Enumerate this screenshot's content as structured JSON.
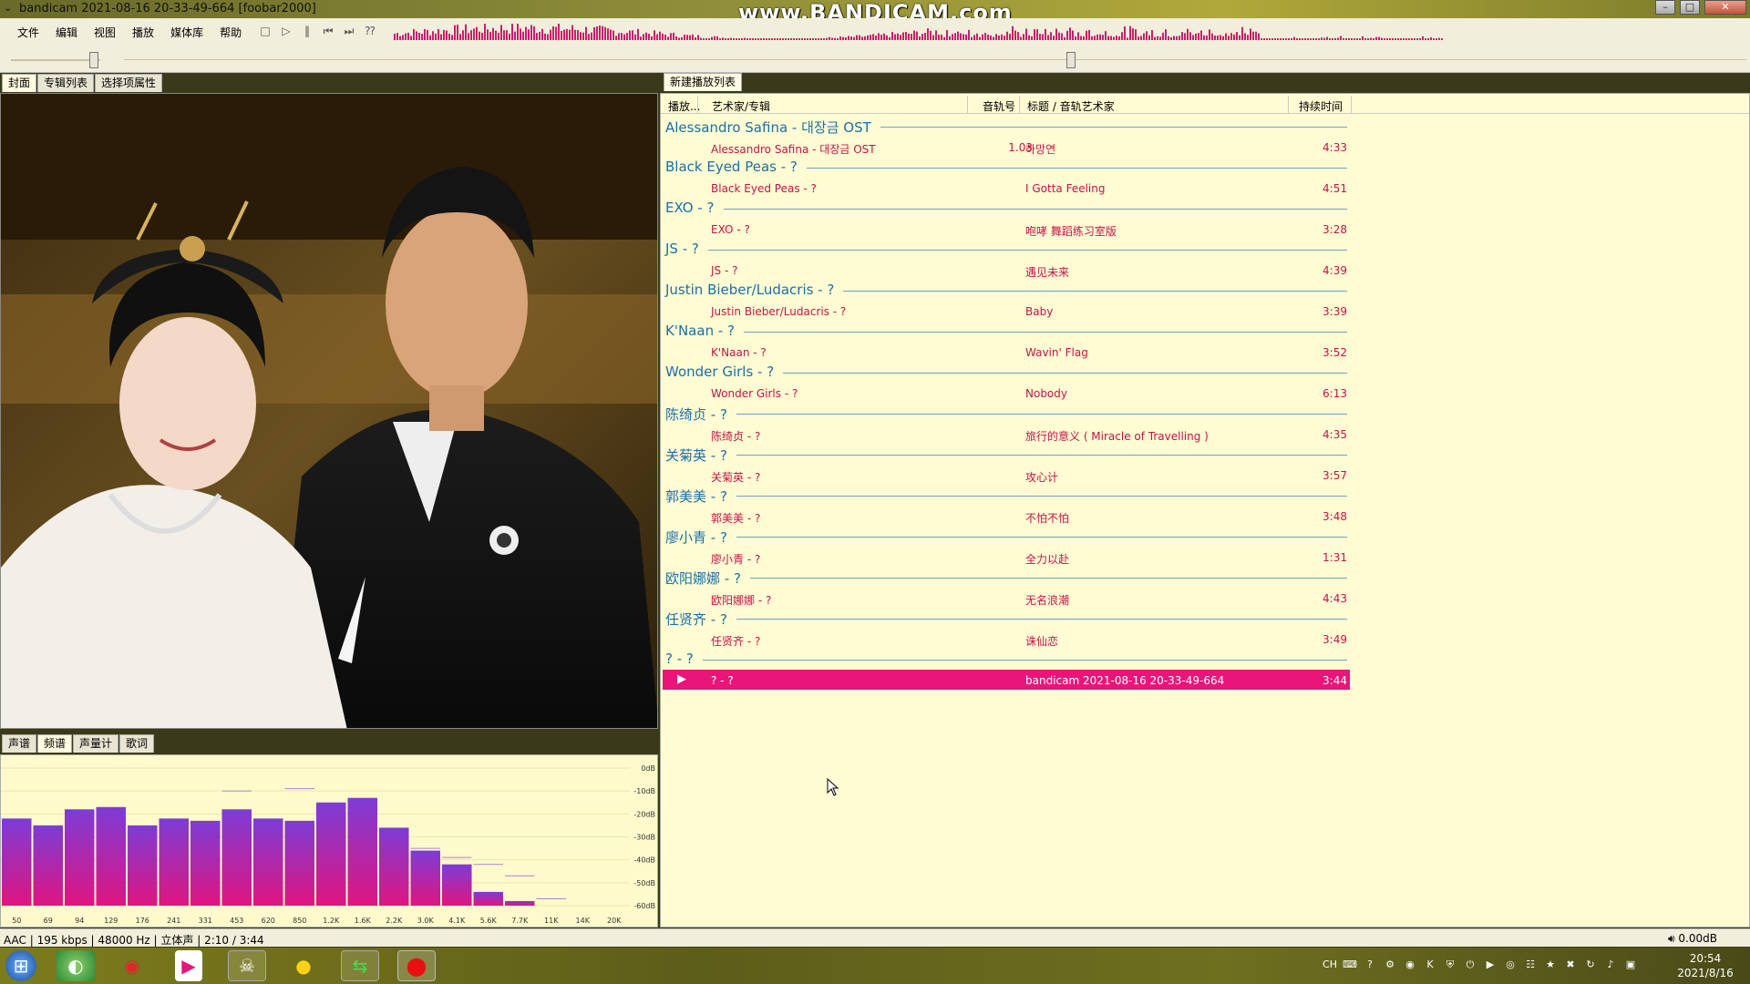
{
  "window": {
    "title": "bandicam 2021-08-16 20-33-49-664  [foobar2000]",
    "watermark": "www.BANDICAM.com",
    "controls": [
      "–",
      "□",
      "✕"
    ]
  },
  "menu": [
    "文件",
    "编辑",
    "视图",
    "播放",
    "媒体库",
    "帮助"
  ],
  "transport": [
    {
      "name": "stop-icon",
      "glyph": "□"
    },
    {
      "name": "play-icon",
      "glyph": "▷"
    },
    {
      "name": "pause-icon",
      "glyph": "‖"
    },
    {
      "name": "previous-icon",
      "glyph": "⏮"
    },
    {
      "name": "next-icon",
      "glyph": "⏭"
    },
    {
      "name": "random-icon",
      "glyph": "⁇"
    }
  ],
  "left_top_tabs": [
    "封面",
    "专辑列表",
    "选择项属性"
  ],
  "left_bottom_tabs": [
    "声谱",
    "频谱",
    "声量计",
    "歌词"
  ],
  "right_tabs": [
    "新建播放列表"
  ],
  "playlist": {
    "columns": {
      "playing": "播放...",
      "artist_album": "艺术家/专辑",
      "track_no": "音轨号",
      "title_artist": "标题 / 音轨艺术家",
      "duration": "持续时间"
    },
    "groups": [
      {
        "header": "Alessandro Safina - 대장금 OST",
        "tracks": [
          {
            "artist": "Alessandro Safina - 대장금 OST",
            "num": "1.03",
            "title": "하망연",
            "duration": "4:33"
          }
        ]
      },
      {
        "header": "Black Eyed Peas - ?",
        "tracks": [
          {
            "artist": "Black Eyed Peas - ?",
            "num": "",
            "title": "I Gotta Feeling",
            "duration": "4:51"
          }
        ]
      },
      {
        "header": "EXO - ?",
        "tracks": [
          {
            "artist": "EXO - ?",
            "num": "",
            "title": "咆哮 舞蹈练习室版",
            "duration": "3:28"
          }
        ]
      },
      {
        "header": "JS - ?",
        "tracks": [
          {
            "artist": "JS - ?",
            "num": "",
            "title": "遇见未来",
            "duration": "4:39"
          }
        ]
      },
      {
        "header": "Justin Bieber/Ludacris - ?",
        "tracks": [
          {
            "artist": "Justin Bieber/Ludacris - ?",
            "num": "",
            "title": "Baby",
            "duration": "3:39"
          }
        ]
      },
      {
        "header": "K'Naan - ?",
        "tracks": [
          {
            "artist": "K'Naan - ?",
            "num": "",
            "title": "Wavin' Flag",
            "duration": "3:52"
          }
        ]
      },
      {
        "header": "Wonder Girls - ?",
        "tracks": [
          {
            "artist": "Wonder Girls - ?",
            "num": "",
            "title": "Nobody",
            "duration": "6:13"
          }
        ]
      },
      {
        "header": "陈绮贞 - ?",
        "tracks": [
          {
            "artist": "陈绮贞 - ?",
            "num": "",
            "title": "旅行的意义 ( Miracle of Travelling )",
            "duration": "4:35"
          }
        ]
      },
      {
        "header": "关菊英 - ?",
        "tracks": [
          {
            "artist": "关菊英 - ?",
            "num": "",
            "title": "攻心计",
            "duration": "3:57"
          }
        ]
      },
      {
        "header": "郭美美 - ?",
        "tracks": [
          {
            "artist": "郭美美 - ?",
            "num": "",
            "title": "不怕不怕",
            "duration": "3:48"
          }
        ]
      },
      {
        "header": "廖小青 - ?",
        "tracks": [
          {
            "artist": "廖小青 - ?",
            "num": "",
            "title": "全力以赴",
            "duration": "1:31"
          }
        ]
      },
      {
        "header": "欧阳娜娜 - ?",
        "tracks": [
          {
            "artist": "欧阳娜娜 - ?",
            "num": "",
            "title": "无名浪潮",
            "duration": "4:43"
          }
        ]
      },
      {
        "header": "任贤齐 - ?",
        "tracks": [
          {
            "artist": "任贤齐 - ?",
            "num": "",
            "title": "诛仙恋",
            "duration": "3:49"
          }
        ]
      },
      {
        "header": "? - ?",
        "tracks": [
          {
            "artist": "? - ?",
            "num": "",
            "title": "bandicam 2021-08-16 20-33-49-664",
            "duration": "3:44",
            "playing": true
          }
        ]
      }
    ]
  },
  "spectrum": {
    "freq_labels": [
      "50",
      "69",
      "94",
      "129",
      "176",
      "241",
      "331",
      "453",
      "620",
      "850",
      "1.2K",
      "1.6K",
      "2.2K",
      "3.0K",
      "4.1K",
      "5.6K",
      "7.7K",
      "11K",
      "14K",
      "20K"
    ],
    "db_labels": [
      "0dB",
      "-10dB",
      "-20dB",
      "-30dB",
      "-40dB",
      "-50dB",
      "-60dB"
    ],
    "levels_db": [
      -22,
      -25,
      -18,
      -17,
      -25,
      -22,
      -23,
      -18,
      -22,
      -23,
      -15,
      -13,
      -26,
      -36,
      -42,
      -54,
      -58,
      -60,
      -60,
      -60
    ],
    "peaks_db": [
      -22,
      -25,
      -18,
      -17,
      -25,
      -22,
      -23,
      -10,
      -22,
      -9,
      -15,
      -13,
      -26,
      -35,
      -39,
      -42,
      -47,
      -57,
      -60,
      -60
    ],
    "colors": {
      "top": "#7c3cd6",
      "bottom": "#e0157f"
    }
  },
  "status": {
    "text": "AAC | 195 kbps | 48000 Hz | 立体声 | 2:10 / 3:44",
    "volume": "0.00dB",
    "progress_fraction": 0.584
  },
  "taskbar": {
    "apps": [
      "start-orb-icon",
      "browser-icon",
      "netease-music-icon",
      "youku-icon",
      "alien-app-icon",
      "media-player-icon",
      "green-app-icon",
      "bandicam-record-icon"
    ],
    "clock_time": "20:54",
    "clock_date": "2021/8/16",
    "ime": "CH"
  }
}
